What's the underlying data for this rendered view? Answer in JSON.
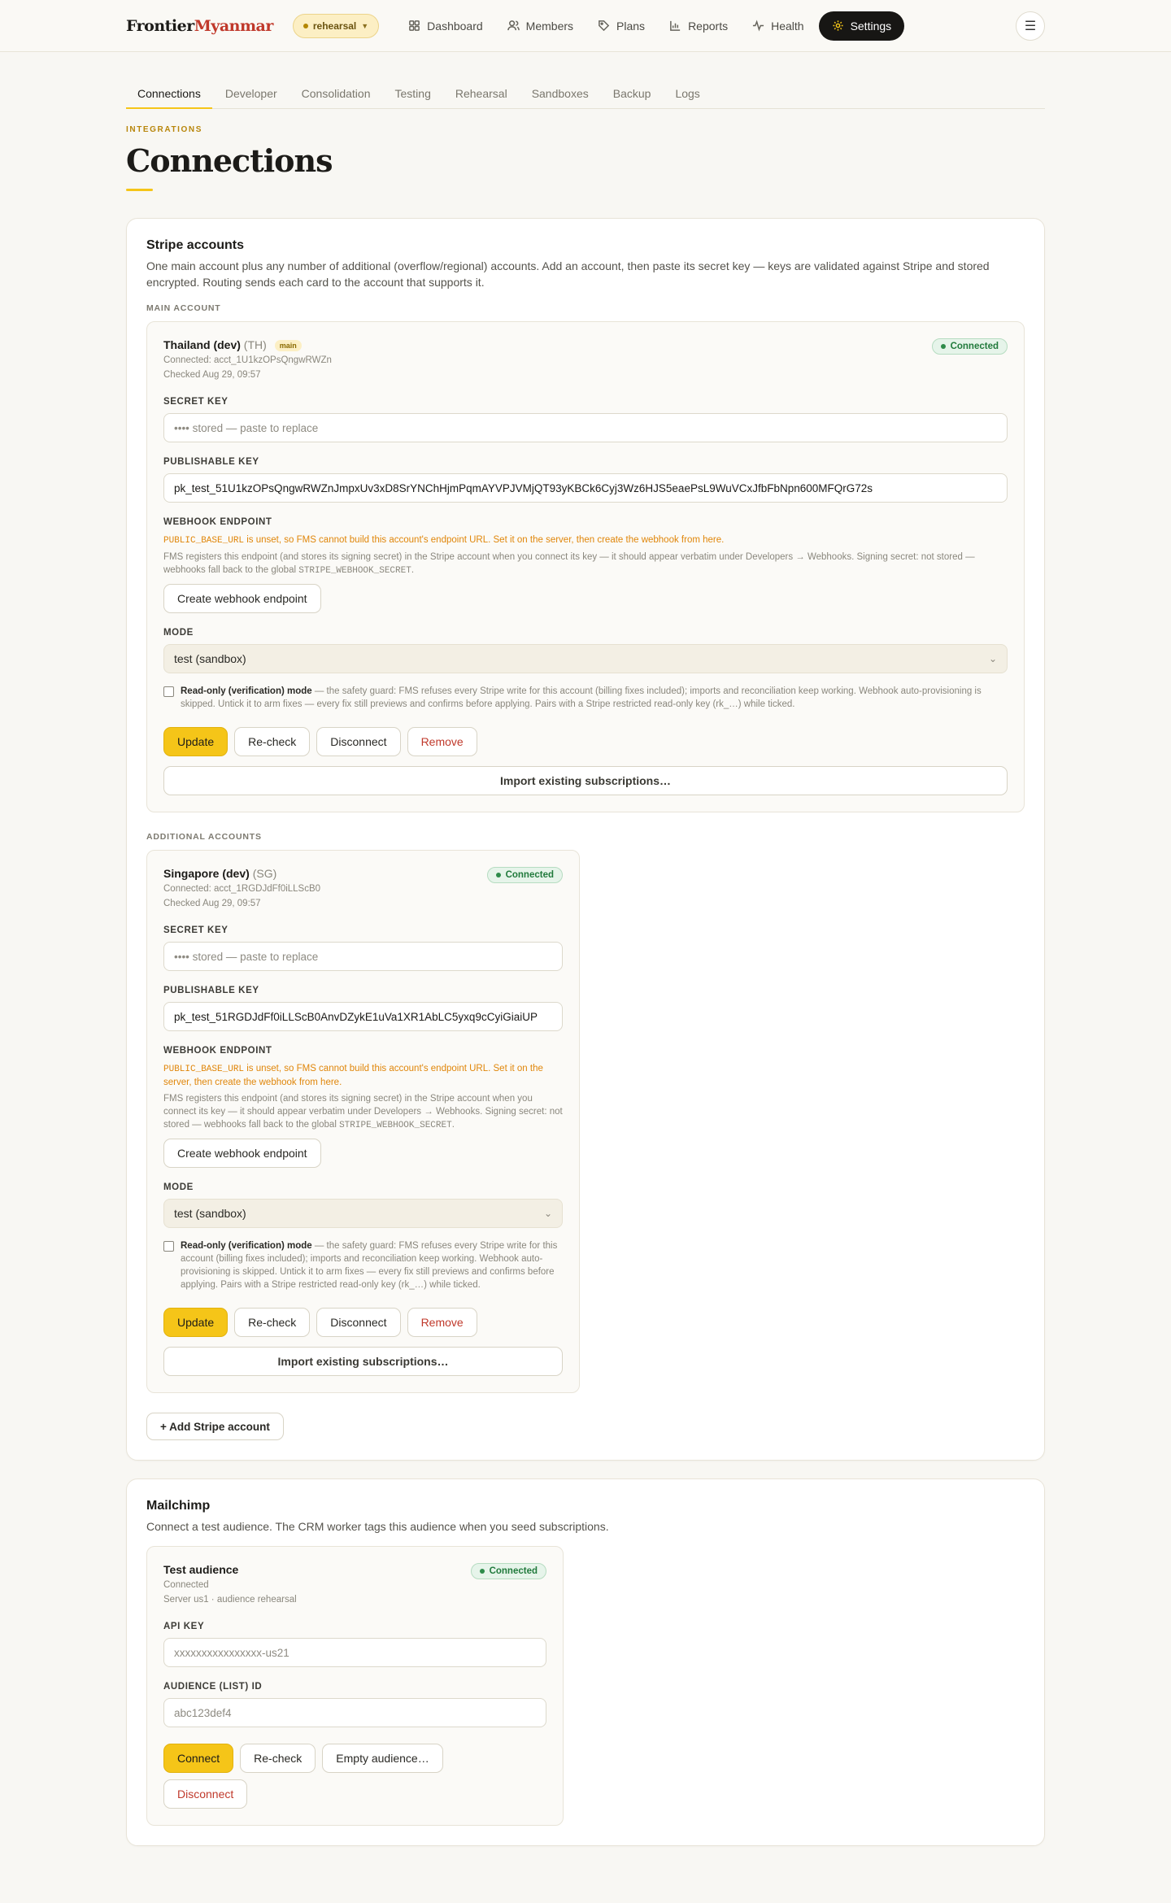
{
  "brand": {
    "part1": "Frontier",
    "part2": "Myanmar"
  },
  "env": {
    "label": "rehearsal"
  },
  "nav": [
    {
      "label": "Dashboard",
      "icon": "grid-icon"
    },
    {
      "label": "Members",
      "icon": "users-icon"
    },
    {
      "label": "Plans",
      "icon": "tag-icon"
    },
    {
      "label": "Reports",
      "icon": "bar-chart-icon"
    },
    {
      "label": "Health",
      "icon": "pulse-icon"
    },
    {
      "label": "Settings",
      "icon": "gear-icon",
      "active": true
    }
  ],
  "menu_icon": "hamburger-icon",
  "subtabs": [
    "Connections",
    "Developer",
    "Consolidation",
    "Testing",
    "Rehearsal",
    "Sandboxes",
    "Backup",
    "Logs"
  ],
  "header": {
    "eyebrow": "INTEGRATIONS",
    "title": "Connections"
  },
  "stripe": {
    "title": "Stripe accounts",
    "desc": "One main account plus any number of additional (overflow/regional) accounts. Add an account, then paste its secret key — keys are validated against Stripe and stored encrypted. Routing sends each card to the account that supports it.",
    "main_label": "MAIN ACCOUNT",
    "additional_label": "ADDITIONAL ACCOUNTS",
    "add_button": "+ Add Stripe account",
    "labels": {
      "secret_key": "SECRET KEY",
      "publishable_key": "PUBLISHABLE KEY",
      "webhook": "WEBHOOK ENDPOINT",
      "mode": "MODE"
    },
    "warn_code": "PUBLIC_BASE_URL",
    "warn_text": " is unset, so FMS cannot build this account's endpoint URL. Set it on the server, then create the webhook from here.",
    "hint_text": "FMS registers this endpoint (and stores its signing secret) in the Stripe account when you connect its key — it should appear verbatim under Developers → Webhooks. Signing secret: not stored — webhooks fall back to the global ",
    "hint_code": "STRIPE_WEBHOOK_SECRET",
    "hint_end": ".",
    "create_webhook": "Create webhook endpoint",
    "readonly_bold": "Read-only (verification) mode",
    "readonly_text": " — the safety guard: FMS refuses every Stripe write for this account (billing fixes included); imports and reconciliation keep working. Webhook auto-provisioning is skipped. Untick it to arm fixes — every fix still previews and confirms before applying. Pairs with a Stripe restricted read-only key (rk_…) while ticked.",
    "buttons": {
      "update": "Update",
      "recheck": "Re-check",
      "disconnect": "Disconnect",
      "remove": "Remove",
      "import": "Import existing subscriptions…"
    },
    "main_account": {
      "name": "Thailand (dev)",
      "cc": "(TH)",
      "tag": "main",
      "status": "Connected",
      "connected": "Connected: acct_1U1kzOPsQngwRWZn",
      "checked": "Checked Aug 29, 09:57",
      "secret_placeholder": "•••• stored — paste to replace",
      "publishable": "pk_test_51U1kzOPsQngwRWZnJmpxUv3xD8SrYNChHjmPqmAYVPJVMjQT93yKBCk6Cyj3Wz6HJS5eaePsL9WuVCxJfbFbNpn600MFQrG72s",
      "mode": "test (sandbox)"
    },
    "additional_accounts": [
      {
        "name": "Singapore (dev)",
        "cc": "(SG)",
        "status": "Connected",
        "connected": "Connected: acct_1RGDJdFf0iLLScB0",
        "checked": "Checked Aug 29, 09:57",
        "secret_placeholder": "•••• stored — paste to replace",
        "publishable": "pk_test_51RGDJdFf0iLLScB0AnvDZykE1uVa1XR1AbLC5yxq9cCyiGiaiUP",
        "mode": "test (sandbox)"
      }
    ]
  },
  "mailchimp": {
    "title": "Mailchimp",
    "desc": "Connect a test audience. The CRM worker tags this audience when you seed subscriptions.",
    "audience_name": "Test audience",
    "status": "Connected",
    "meta1": "Connected",
    "meta2": "Server us1 · audience rehearsal",
    "api_label": "API KEY",
    "api_placeholder": "xxxxxxxxxxxxxxxx-us21",
    "list_label": "AUDIENCE (LIST) ID",
    "list_placeholder": "abc123def4",
    "buttons": {
      "connect": "Connect",
      "recheck": "Re-check",
      "empty": "Empty audience…",
      "disconnect": "Disconnect"
    }
  },
  "colors": {
    "accent": "#f5c518",
    "brand_red": "#c0392b",
    "success": "#217a3c",
    "warning": "#e0860a"
  }
}
